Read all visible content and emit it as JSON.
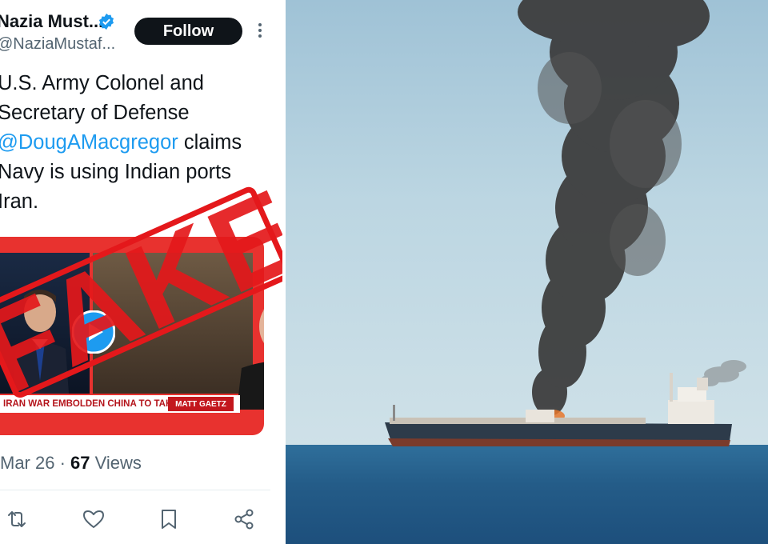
{
  "tweet": {
    "display_name": "Nazia Must...",
    "handle": "@NaziaMustaf...",
    "follow_label": "Follow",
    "text_lines": [
      "U.S. Army Colonel and",
      "Secretary of Defense",
      "claims",
      "Navy is using Indian ports",
      "Iran."
    ],
    "mention": "@DougAMacgregor",
    "date": "Mar 26",
    "separator": " · ",
    "views_count": "67",
    "views_label": " Views",
    "actions": [
      "retweet-icon",
      "heart-icon",
      "bookmark-icon",
      "share-icon"
    ]
  },
  "media": {
    "ticker_text": "IRAN WAR EMBOLDEN CHINA TO TAKE TAIWAN?",
    "show_badge": "MATT GAETZ",
    "stamp_text": "FAKE",
    "stamp_color": "#e4181b"
  },
  "colors": {
    "link": "#1d9bf0",
    "text": "#0f1419",
    "secondary": "#536471",
    "follow_bg": "#0f1419"
  }
}
